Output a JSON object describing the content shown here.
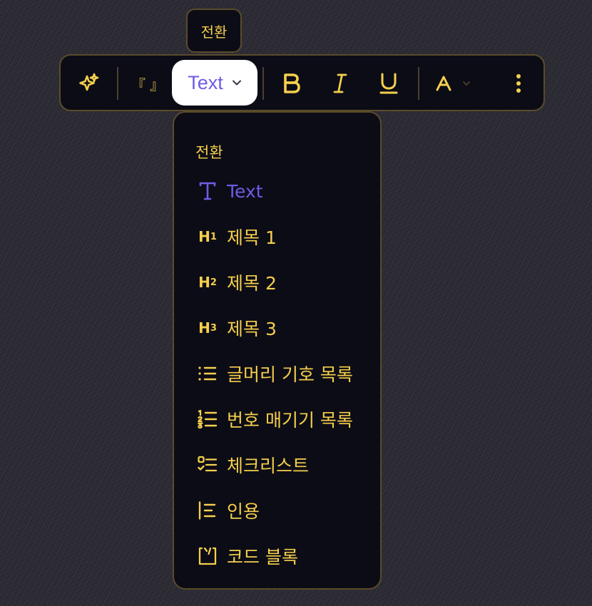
{
  "tooltip": {
    "text": "전환"
  },
  "toolbar": {
    "quote_glyph": "『 』",
    "convert_label": "Text",
    "text_color_glyph": "A"
  },
  "dropdown": {
    "header": "전환",
    "items": [
      {
        "label": "Text",
        "icon": "text-type-icon",
        "active": true
      },
      {
        "label": "제목 1",
        "icon": "heading-1-icon"
      },
      {
        "label": "제목 2",
        "icon": "heading-2-icon"
      },
      {
        "label": "제목 3",
        "icon": "heading-3-icon"
      },
      {
        "label": "글머리 기호 목록",
        "icon": "bullet-list-icon"
      },
      {
        "label": "번호 매기기 목록",
        "icon": "numbered-list-icon"
      },
      {
        "label": "체크리스트",
        "icon": "checklist-icon"
      },
      {
        "label": "인용",
        "icon": "quote-block-icon"
      },
      {
        "label": "코드 블록",
        "icon": "code-block-icon"
      }
    ]
  },
  "heading_icon_glyphs": {
    "h": "H",
    "n1": "1",
    "n2": "2",
    "n3": "3"
  },
  "colors": {
    "accent_yellow": "#f5cf4c",
    "accent_purple": "#6c5de6",
    "panel_bg": "#0c0c16",
    "panel_border": "#5a4b2a"
  }
}
